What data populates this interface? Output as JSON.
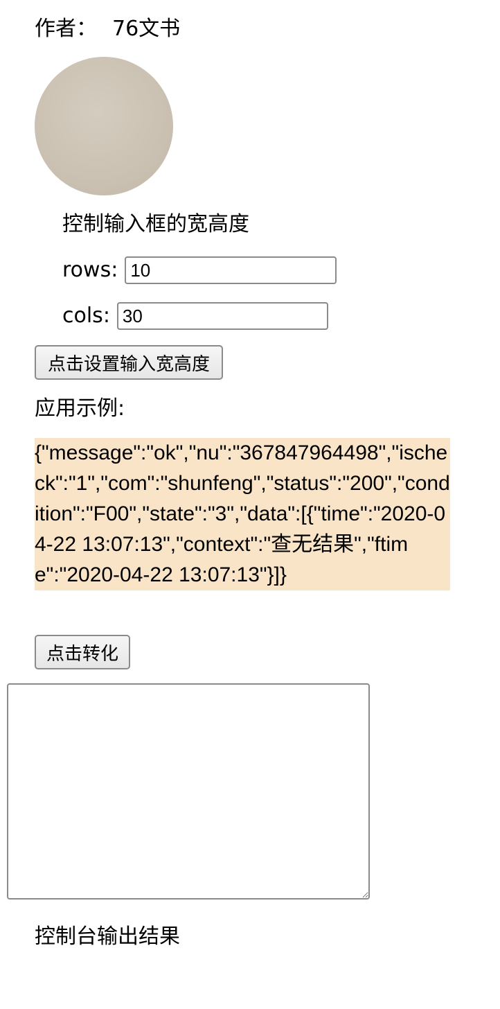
{
  "author": {
    "label": "作者：",
    "name": "76文书"
  },
  "avatar": {
    "color": "#cbc2b3"
  },
  "size_control": {
    "title": "控制输入框的宽高度",
    "rows_label": "rows:",
    "rows_value": "10",
    "cols_label": "cols:",
    "cols_value": "30",
    "button_label": "点击设置输入宽高度"
  },
  "example": {
    "label": "应用示例:",
    "json_text": "{\"message\":\"ok\",\"nu\":\"367847964498\",\"ischeck\":\"1\",\"com\":\"shunfeng\",\"status\":\"200\",\"condition\":\"F00\",\"state\":\"3\",\"data\":[{\"time\":\"2020-04-22 13:07:13\",\"context\":\"查无结果\",\"ftime\":\"2020-04-22 13:07:13\"}]}",
    "background": "#f9e4c8"
  },
  "convert": {
    "button_label": "点击转化"
  },
  "output": {
    "value": ""
  },
  "console": {
    "label": "控制台输出结果"
  }
}
